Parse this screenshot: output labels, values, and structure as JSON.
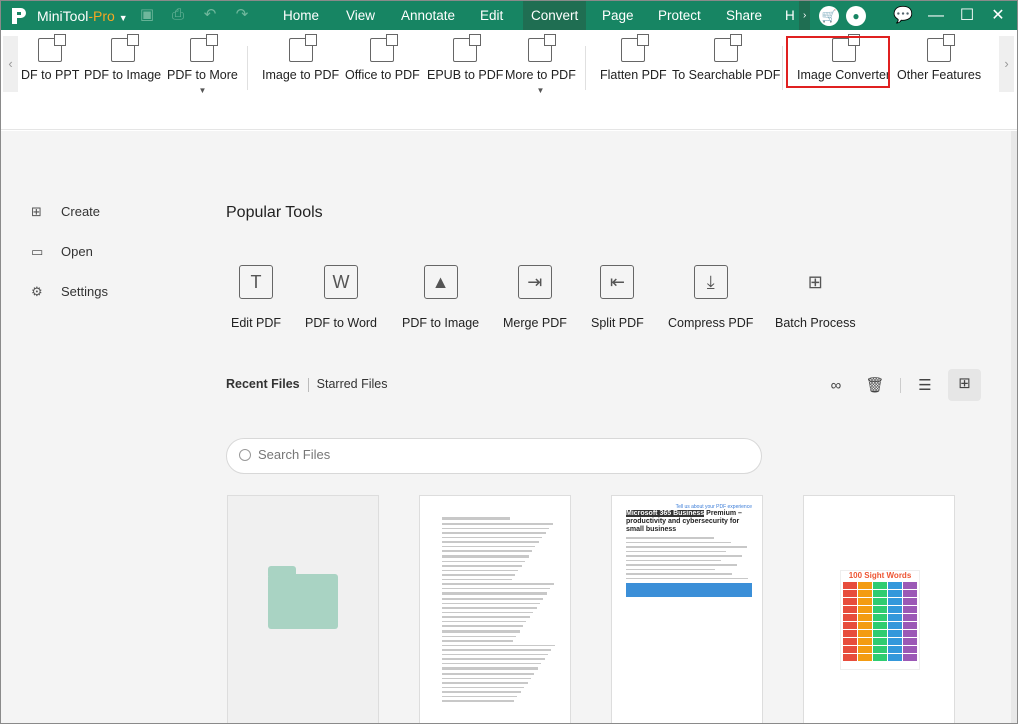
{
  "app": {
    "name": "MiniTool",
    "edition": "-Pro"
  },
  "menu": [
    "Home",
    "View",
    "Annotate",
    "Edit",
    "Convert",
    "Page",
    "Protect",
    "Share",
    "H"
  ],
  "menu_active": "Convert",
  "ribbon": {
    "items": [
      "DF to PPT",
      "PDF to Image",
      "PDF to More",
      "Image to PDF",
      "Office to PDF",
      "EPUB to PDF",
      "More to PDF",
      "Flatten PDF",
      "To Searchable PDF",
      "Image Converter",
      "Other Features"
    ],
    "highlighted": "Image Converter"
  },
  "nav": [
    {
      "label": "Create",
      "icon": "create-icon"
    },
    {
      "label": "Open",
      "icon": "folder-icon"
    },
    {
      "label": "Settings",
      "icon": "gear-icon"
    }
  ],
  "popular": {
    "title": "Popular Tools",
    "tools": [
      "Edit PDF",
      "PDF to Word",
      "PDF to Image",
      "Merge PDF",
      "Split PDF",
      "Compress PDF",
      "Batch Process"
    ]
  },
  "files": {
    "tabs": [
      "Recent Files",
      "Starred Files"
    ],
    "active_tab": "Recent Files",
    "search_placeholder": "Search Files",
    "view": "grid"
  },
  "thumbnails": {
    "ms_link": "Tell us about your PDF experience",
    "ms_highlight": "Microsoft 365 Business",
    "ms_title": " Premium – productivity and cybersecurity for small business",
    "sight_title": "100 Sight Words"
  },
  "colors": {
    "titlebar": "#178563",
    "highlight": "#e02020",
    "accent_pro": "#f5a623"
  }
}
